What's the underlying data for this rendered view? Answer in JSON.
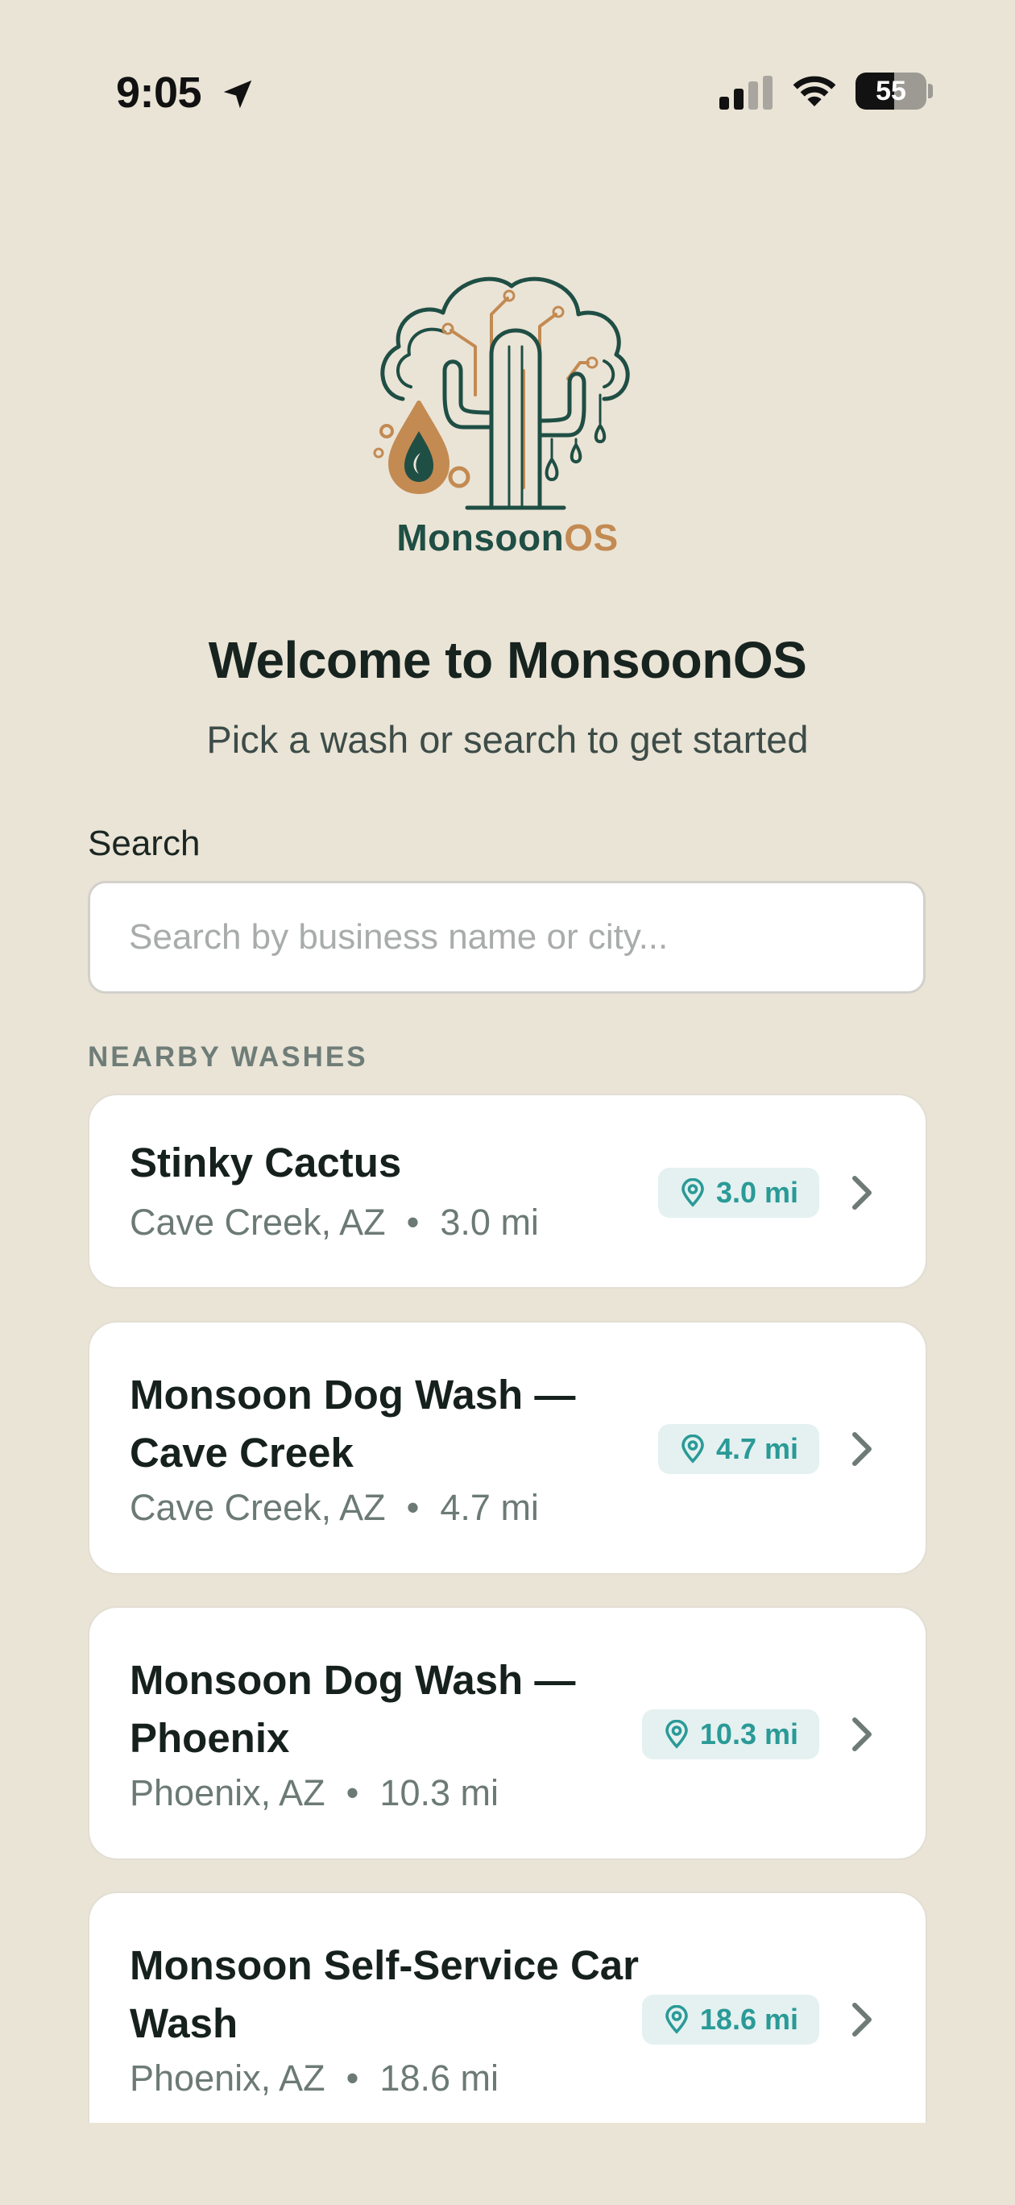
{
  "status": {
    "time": "9:05",
    "battery": "55",
    "battery_level": 0.55
  },
  "brand": {
    "name_part1": "Monsoon",
    "name_part2": "OS",
    "primary_color": "#1F4E44",
    "accent_color": "#C38A52"
  },
  "welcome": {
    "title": "Welcome to MonsoonOS",
    "subtitle": "Pick a wash or search to get started"
  },
  "search": {
    "label": "Search",
    "placeholder": "Search by business name or city..."
  },
  "nearby": {
    "heading": "NEARBY WASHES",
    "items": [
      {
        "name": "Stinky Cactus",
        "location": "Cave Creek, AZ",
        "distance": "3.0 mi",
        "badge": "3.0 mi"
      },
      {
        "name": "Monsoon Dog Wash — Cave Creek",
        "location": "Cave Creek, AZ",
        "distance": "4.7 mi",
        "badge": "4.7 mi"
      },
      {
        "name": "Monsoon Dog Wash — Phoenix",
        "location": "Phoenix, AZ",
        "distance": "10.3 mi",
        "badge": "10.3 mi"
      },
      {
        "name": "Monsoon Self-Service Car Wash",
        "location": "Phoenix, AZ",
        "distance": "18.6 mi",
        "badge": "18.6 mi"
      }
    ]
  },
  "colors": {
    "background": "#EAE4D6",
    "badge_bg": "#E4F1F0",
    "badge_text": "#2A9A97"
  },
  "icons": [
    "location-arrow-icon",
    "cellular-signal-icon",
    "wifi-icon",
    "battery-icon",
    "map-pin-icon",
    "chevron-right-icon"
  ]
}
